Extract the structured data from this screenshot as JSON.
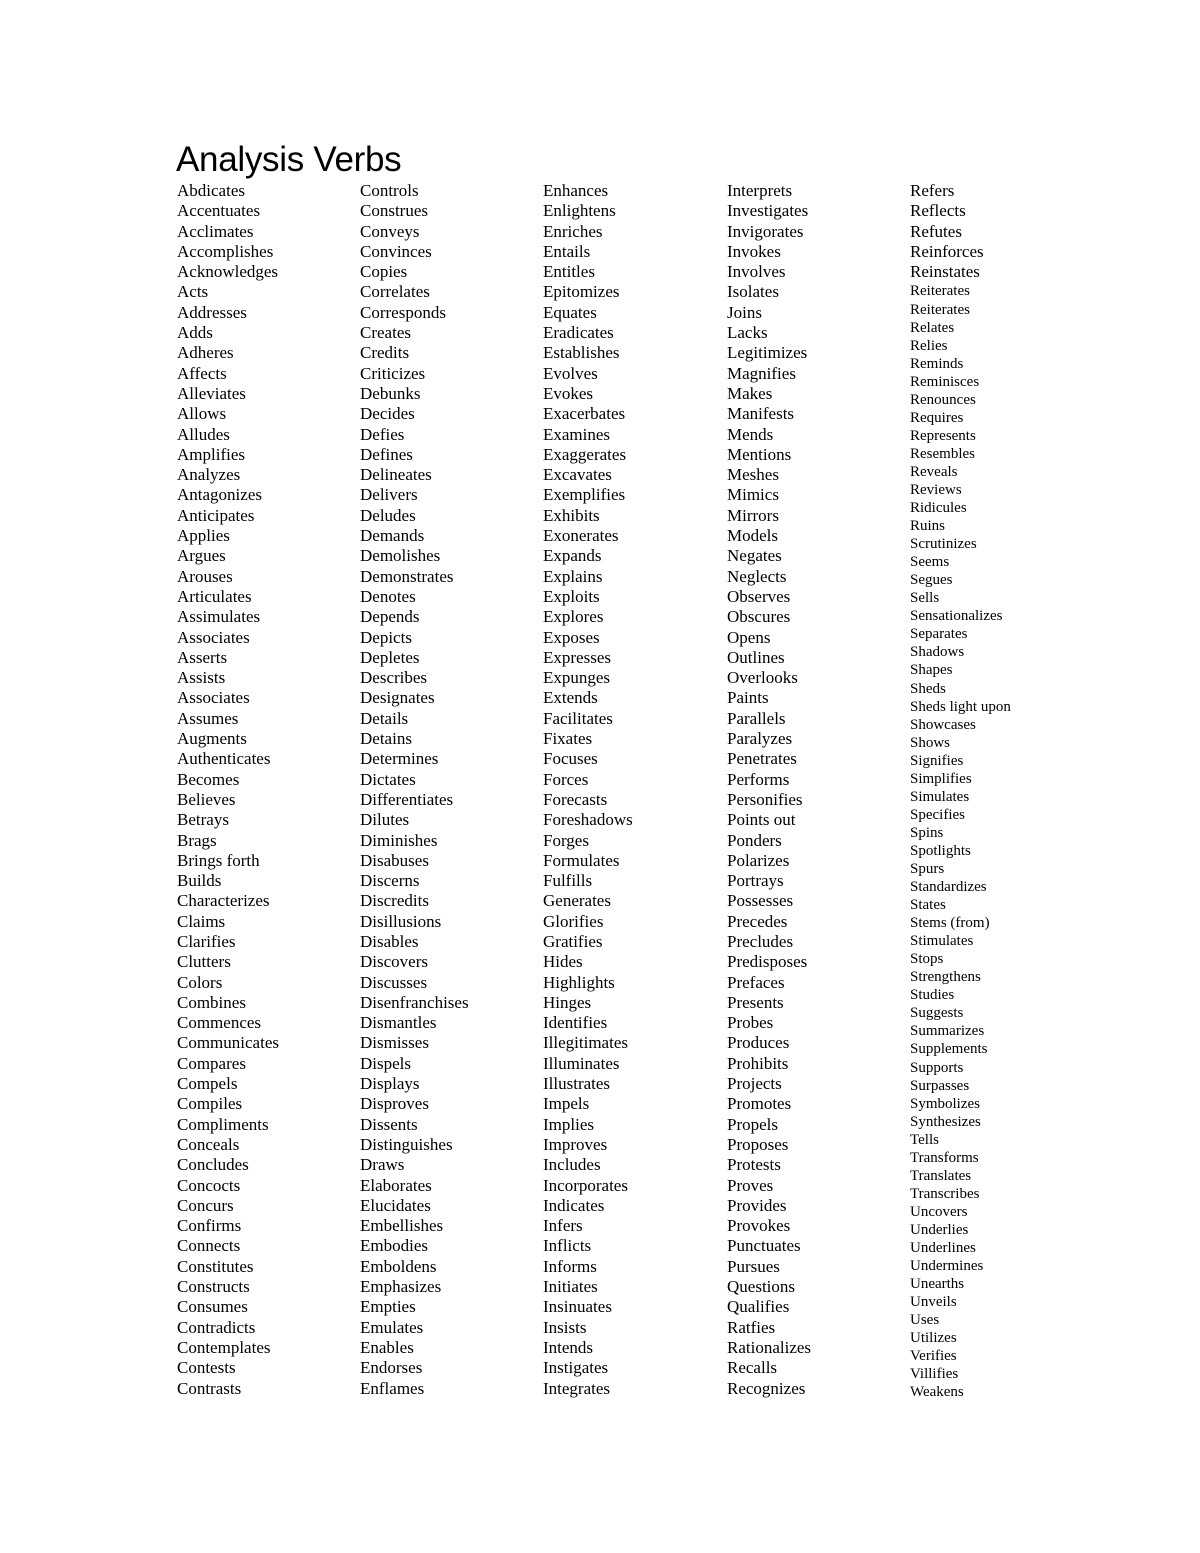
{
  "document": {
    "title": "Analysis Verbs",
    "columns": [
      [
        "Abdicates",
        "Accentuates",
        "Acclimates",
        "Accomplishes",
        "Acknowledges",
        "Acts",
        "Addresses",
        "Adds",
        "Adheres",
        "Affects",
        "Alleviates",
        "Allows",
        "Alludes",
        "Amplifies",
        "Analyzes",
        "Antagonizes",
        "Anticipates",
        "Applies",
        "Argues",
        "Arouses",
        "Articulates",
        "Assimulates",
        "Associates",
        "Asserts",
        "Assists",
        "Associates",
        "Assumes",
        "Augments",
        "Authenticates",
        "Becomes",
        "Believes",
        "Betrays",
        "Brags",
        "Brings forth",
        "Builds",
        "Characterizes",
        "Claims",
        "Clarifies",
        "Clutters",
        "Colors",
        "Combines",
        "Commences",
        "Communicates",
        "Compares",
        "Compels",
        "Compiles",
        "Compliments",
        "Conceals",
        "Concludes",
        "Concocts",
        "Concurs",
        "Confirms",
        "Connects",
        "Constitutes",
        "Constructs",
        "Consumes",
        "Contradicts",
        "Contemplates",
        "Contests",
        "Contrasts"
      ],
      [
        "Controls",
        "Construes",
        "Conveys",
        "Convinces",
        "Copies",
        "Correlates",
        "Corresponds",
        "Creates",
        "Credits",
        "Criticizes",
        "Debunks",
        "Decides",
        "Defies",
        "Defines",
        "Delineates",
        "Delivers",
        "Deludes",
        "Demands",
        "Demolishes",
        "Demonstrates",
        "Denotes",
        "Depends",
        "Depicts",
        "Depletes",
        "Describes",
        "Designates",
        "Details",
        "Detains",
        "Determines",
        "Dictates",
        "Differentiates",
        "Dilutes",
        "Diminishes",
        "Disabuses",
        "Discerns",
        "Discredits",
        "Disillusions",
        "Disables",
        "Discovers",
        "Discusses",
        "Disenfranchises",
        "Dismantles",
        "Dismisses",
        "Dispels",
        "Displays",
        "Disproves",
        "Dissents",
        "Distinguishes",
        "Draws",
        "Elaborates",
        "Elucidates",
        "Embellishes",
        "Embodies",
        "Emboldens",
        "Emphasizes",
        "Empties",
        "Emulates",
        "Enables",
        "Endorses",
        "Enflames"
      ],
      [
        "Enhances",
        "Enlightens",
        "Enriches",
        "Entails",
        "Entitles",
        "Epitomizes",
        "Equates",
        "Eradicates",
        "Establishes",
        "Evolves",
        "Evokes",
        "Exacerbates",
        "Examines",
        "Exaggerates",
        "Excavates",
        "Exemplifies",
        "Exhibits",
        "Exonerates",
        "Expands",
        "Explains",
        "Exploits",
        "Explores",
        "Exposes",
        "Expresses",
        "Expunges",
        "Extends",
        "Facilitates",
        "Fixates",
        "Focuses",
        "Forces",
        "Forecasts",
        "Foreshadows",
        "Forges",
        "Formulates",
        "Fulfills",
        "Generates",
        "Glorifies",
        "Gratifies",
        "Hides",
        "Highlights",
        "Hinges",
        "Identifies",
        "Illegitimates",
        "Illuminates",
        "Illustrates",
        "Impels",
        "Implies",
        "Improves",
        "Includes",
        "Incorporates",
        "Indicates",
        "Infers",
        "Inflicts",
        "Informs",
        "Initiates",
        "Insinuates",
        "Insists",
        "Intends",
        "Instigates",
        "Integrates"
      ],
      [
        "Interprets",
        "Investigates",
        "Invigorates",
        "Invokes",
        "Involves",
        "Isolates",
        "Joins",
        "Lacks",
        "Legitimizes",
        "Magnifies",
        "Makes",
        "Manifests",
        "Mends",
        "Mentions",
        "Meshes",
        "Mimics",
        "Mirrors",
        "Models",
        "Negates",
        "Neglects",
        "Observes",
        "Obscures",
        "Opens",
        "Outlines",
        "Overlooks",
        "Paints",
        "Parallels",
        "Paralyzes",
        "Penetrates",
        "Performs",
        "Personifies",
        "Points out",
        "Ponders",
        "Polarizes",
        "Portrays",
        "Possesses",
        "Precedes",
        "Precludes",
        "Predisposes",
        "Prefaces",
        "Presents",
        "Probes",
        "Produces",
        "Prohibits",
        "Projects",
        "Promotes",
        "Propels",
        "Proposes",
        "Protests",
        "Proves",
        "Provides",
        "Provokes",
        "Punctuates",
        "Pursues",
        "Questions",
        "Qualifies",
        "Ratfies",
        "Rationalizes",
        "Recalls",
        "Recognizes"
      ],
      [
        "Refers",
        "Reflects",
        "Refutes",
        "Reinforces",
        "Reinstates",
        "Reiterates",
        "Reiterates",
        "Relates",
        "Relies",
        "Reminds",
        "Reminisces",
        "Renounces",
        "Requires",
        "Represents",
        "Resembles",
        "Reveals",
        "Reviews",
        "Ridicules",
        "Ruins",
        "Scrutinizes",
        "Seems",
        "Segues",
        "Sells",
        "Sensationalizes",
        "Separates",
        "Shadows",
        "Shapes",
        "Sheds",
        "Sheds light upon",
        "Showcases",
        "Shows",
        "Signifies",
        "Simplifies",
        "Simulates",
        "Specifies",
        "Spins",
        "Spotlights",
        "Spurs",
        "Standardizes",
        "States",
        "Stems (from)",
        "Stimulates",
        "Stops",
        "Strengthens",
        "Studies",
        "Suggests",
        "Summarizes",
        "Supplements",
        "Supports",
        "Surpasses",
        "Symbolizes",
        "Synthesizes",
        "Tells",
        "Transforms",
        "Translates",
        "Transcribes",
        "Uncovers",
        "Underlies",
        "Underlines",
        "Undermines",
        "Unearths",
        "Unveils",
        "Uses",
        "Utilizes",
        "Verifies",
        "Villifies",
        "Weakens"
      ]
    ]
  }
}
